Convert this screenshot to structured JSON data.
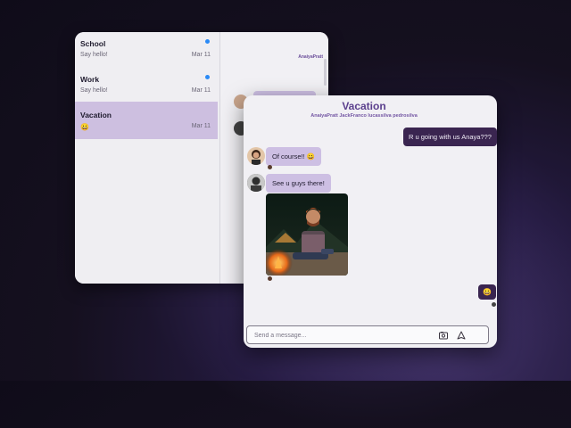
{
  "conversations": [
    {
      "title": "School",
      "preview": "Say hello!",
      "date": "Mar 11",
      "unread": true
    },
    {
      "title": "Work",
      "preview": "Say hello!",
      "date": "Mar 11",
      "unread": true
    },
    {
      "title": "Vacation",
      "preview": "😀",
      "date": "Mar 11",
      "unread": false,
      "active": true
    }
  ],
  "back_chat": {
    "members": "AnaiyaPratt"
  },
  "chat": {
    "title": "Vacation",
    "members": "AnaiyaPratt JackFranco lucassilva pedrosilva",
    "messages": [
      {
        "direction": "out",
        "text": "R u going with us Anaya???"
      },
      {
        "direction": "in",
        "sender_icon": "woman-avatar-icon",
        "text": "Of course!! 😀"
      },
      {
        "direction": "in",
        "sender_icon": "man-avatar-icon",
        "text": "See u guys there!"
      },
      {
        "direction": "in",
        "type": "image",
        "content_icon": "campfire-photo-icon"
      },
      {
        "direction": "out",
        "text": "😀"
      }
    ]
  },
  "composer": {
    "placeholder": "Send a message...",
    "attach_icon": "image-icon",
    "send_icon": "send-icon"
  },
  "colors": {
    "accent": "#5b3f8d",
    "outgoing_bubble": "#3a2550",
    "incoming_bubble": "#cdbfe3",
    "active_conversation": "#cdbfe0",
    "unread_dot": "#2a8af6"
  }
}
